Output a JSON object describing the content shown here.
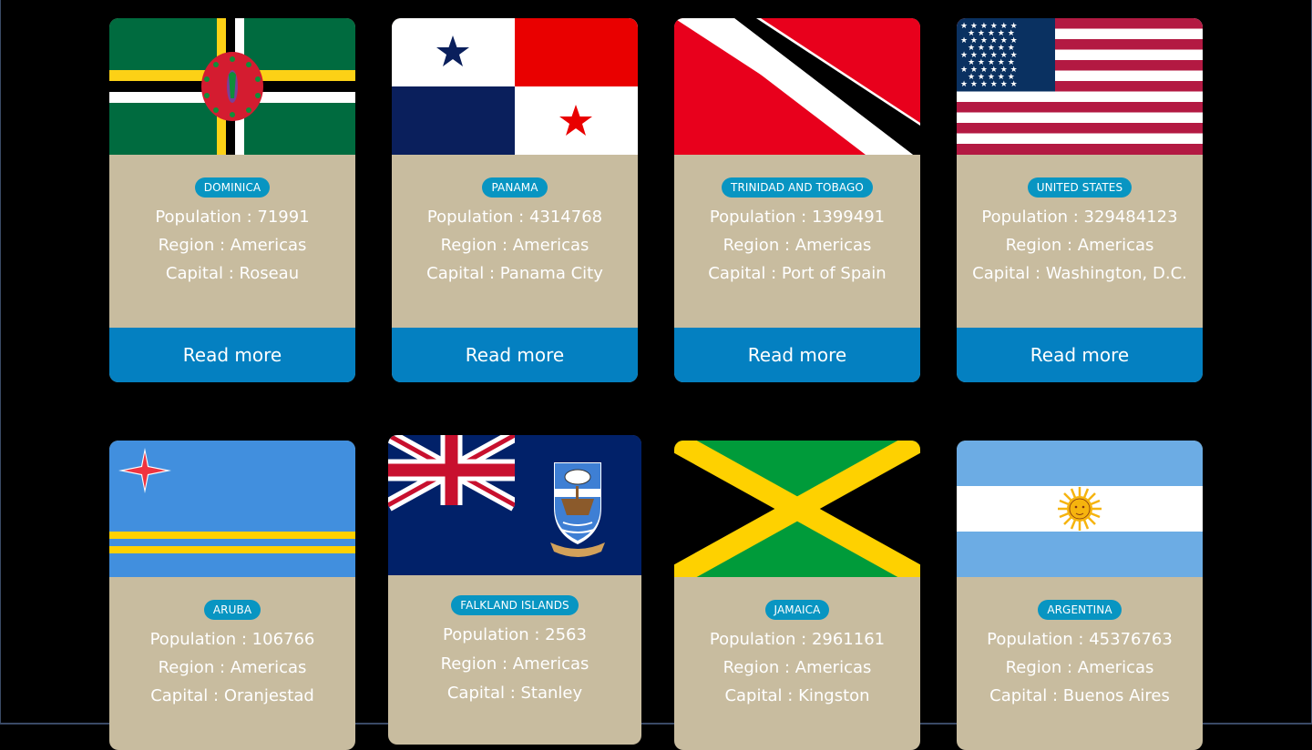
{
  "labels": {
    "population": "Population : ",
    "region": "Region : ",
    "capital": "Capital : ",
    "read_more": "Read more"
  },
  "countries": [
    {
      "name": "DOMINICA",
      "population": "71991",
      "region": "Americas",
      "capital": "Roseau",
      "flag": "dominica-flag"
    },
    {
      "name": "PANAMA",
      "population": "4314768",
      "region": "Americas",
      "capital": "Panama City",
      "flag": "panama-flag"
    },
    {
      "name": "TRINIDAD AND TOBAGO",
      "population": "1399491",
      "region": "Americas",
      "capital": "Port of Spain",
      "flag": "trinidad-and-tobago-flag"
    },
    {
      "name": "UNITED STATES",
      "population": "329484123",
      "region": "Americas",
      "capital": "Washington, D.C.",
      "flag": "united-states-flag"
    },
    {
      "name": "ARUBA",
      "population": "106766",
      "region": "Americas",
      "capital": "Oranjestad",
      "flag": "aruba-flag"
    },
    {
      "name": "FALKLAND ISLANDS",
      "population": "2563",
      "region": "Americas",
      "capital": "Stanley",
      "flag": "falkland-islands-flag"
    },
    {
      "name": "JAMAICA",
      "population": "2961161",
      "region": "Americas",
      "capital": "Kingston",
      "flag": "jamaica-flag"
    },
    {
      "name": "ARGENTINA",
      "population": "45376763",
      "region": "Americas",
      "capital": "Buenos Aires",
      "flag": "argentina-flag"
    }
  ],
  "colors": {
    "page_background": "#000000",
    "card_background": "#c8bc9f",
    "badge_background": "#0895c2",
    "button_background": "#0480c1",
    "text": "#ffffff"
  }
}
